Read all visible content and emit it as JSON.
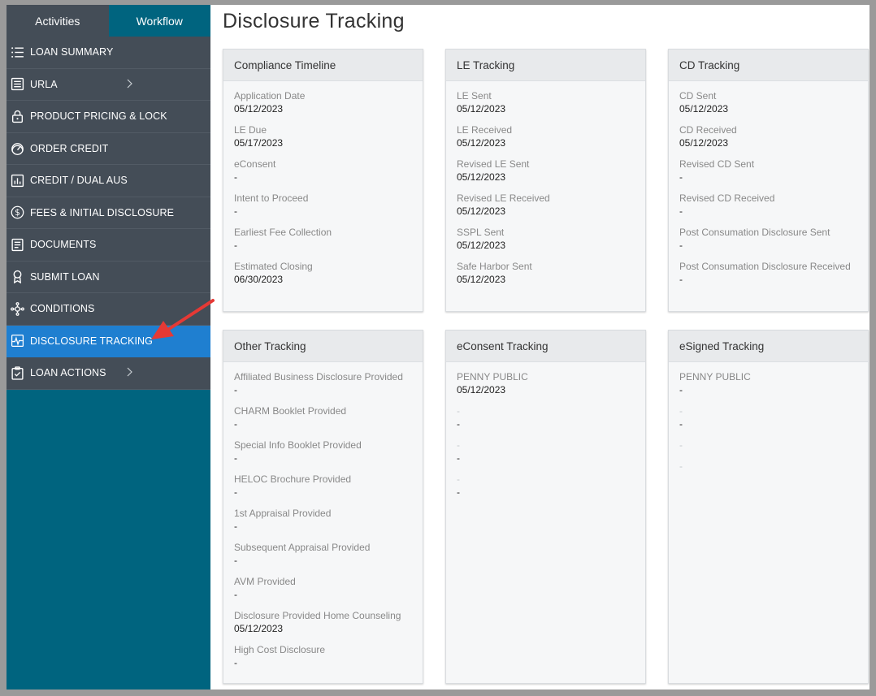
{
  "tabs": [
    {
      "label": "Activities"
    },
    {
      "label": "Workflow"
    }
  ],
  "menu": [
    {
      "label": "LOAN SUMMARY",
      "icon": "list-icon"
    },
    {
      "label": "URLA",
      "icon": "form-icon",
      "chevron": true
    },
    {
      "label": "PRODUCT PRICING & LOCK",
      "icon": "lock-icon"
    },
    {
      "label": "ORDER CREDIT",
      "icon": "gauge-icon"
    },
    {
      "label": "CREDIT / DUAL AUS",
      "icon": "bar-chart-icon"
    },
    {
      "label": "FEES & INITIAL DISCLOSURE",
      "icon": "dollar-icon"
    },
    {
      "label": "DOCUMENTS",
      "icon": "document-icon"
    },
    {
      "label": "SUBMIT LOAN",
      "icon": "ribbon-icon"
    },
    {
      "label": "CONDITIONS",
      "icon": "network-icon"
    },
    {
      "label": "DISCLOSURE TRACKING",
      "icon": "pulse-icon",
      "active": true
    },
    {
      "label": "LOAN ACTIONS",
      "icon": "clipboard-check-icon",
      "chevron": true
    }
  ],
  "page_title": "Disclosure Tracking",
  "cards": [
    {
      "title": "Compliance Timeline",
      "fields": [
        {
          "label": "Application Date",
          "value": "05/12/2023"
        },
        {
          "label": "LE Due",
          "value": "05/17/2023"
        },
        {
          "label": "eConsent",
          "value": "-"
        },
        {
          "label": "Intent to Proceed",
          "value": "-"
        },
        {
          "label": "Earliest Fee Collection",
          "value": "-"
        },
        {
          "label": "Estimated Closing",
          "value": "06/30/2023"
        }
      ]
    },
    {
      "title": "LE Tracking",
      "fields": [
        {
          "label": "LE Sent",
          "value": "05/12/2023"
        },
        {
          "label": "LE Received",
          "value": "05/12/2023"
        },
        {
          "label": "Revised LE Sent",
          "value": "05/12/2023"
        },
        {
          "label": "Revised LE Received",
          "value": "05/12/2023"
        },
        {
          "label": "SSPL Sent",
          "value": "05/12/2023"
        },
        {
          "label": "Safe Harbor Sent",
          "value": "05/12/2023"
        }
      ]
    },
    {
      "title": "CD Tracking",
      "fields": [
        {
          "label": "CD Sent",
          "value": "05/12/2023"
        },
        {
          "label": "CD Received",
          "value": "05/12/2023"
        },
        {
          "label": "Revised CD Sent",
          "value": "-"
        },
        {
          "label": "Revised CD Received",
          "value": "-"
        },
        {
          "label": "Post Consumation Disclosure Sent",
          "value": "-"
        },
        {
          "label": "Post Consumation Disclosure Received",
          "value": "-"
        }
      ]
    },
    {
      "title": "Other Tracking",
      "fields": [
        {
          "label": "Affiliated Business Disclosure Provided",
          "value": "-"
        },
        {
          "label": "CHARM Booklet Provided",
          "value": "-"
        },
        {
          "label": "Special Info Booklet Provided",
          "value": "-"
        },
        {
          "label": "HELOC Brochure Provided",
          "value": "-"
        },
        {
          "label": "1st Appraisal Provided",
          "value": "-"
        },
        {
          "label": "Subsequent Appraisal Provided",
          "value": "-"
        },
        {
          "label": "AVM Provided",
          "value": "-"
        },
        {
          "label": "Disclosure Provided Home Counseling",
          "value": "05/12/2023"
        },
        {
          "label": "High Cost Disclosure",
          "value": "-"
        }
      ]
    },
    {
      "title": "eConsent Tracking",
      "fields": [
        {
          "label": "PENNY PUBLIC",
          "value": "05/12/2023"
        },
        {
          "label": "-",
          "value": "-"
        },
        {
          "label": "-",
          "value": "-"
        },
        {
          "label": "-",
          "value": "-"
        }
      ]
    },
    {
      "title": "eSigned Tracking",
      "fields": [
        {
          "label": "PENNY PUBLIC",
          "value": "-"
        },
        {
          "label": "-",
          "value": "-"
        },
        {
          "label": "-",
          "value": ""
        },
        {
          "label": "-",
          "value": ""
        }
      ]
    }
  ],
  "colors": {
    "sidebar_teal": "#00647f",
    "menu_gray": "#444d57",
    "active_blue": "#1f7fd0",
    "arrow_red": "#e53935"
  }
}
